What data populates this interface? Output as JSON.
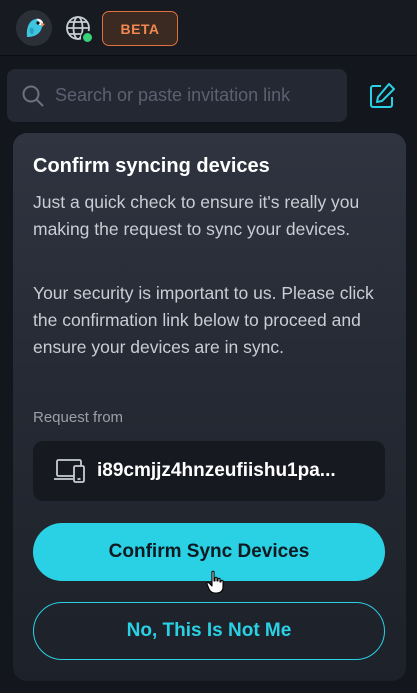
{
  "topbar": {
    "avatar_icon": "parrot-avatar-icon",
    "globe_icon": "globe-icon",
    "status_color": "#36d37a",
    "beta_label": "BETA"
  },
  "search": {
    "placeholder": "Search or paste invitation link",
    "value": "",
    "icon": "search-icon"
  },
  "compose_icon": "compose-icon",
  "card": {
    "title": "Confirm syncing devices",
    "paragraph1": "Just a quick check to ensure it's really you making the request to sync your devices.",
    "paragraph2": "Your security is important to us. Please click the confirmation link below to proceed and ensure your devices are in sync.",
    "request_label": "Request from",
    "device_icon": "devices-icon",
    "device_id": "i89cmjjz4hnzeufiishu1pa...",
    "confirm_label": "Confirm Sync Devices",
    "deny_label": "No, This Is Not Me"
  },
  "colors": {
    "accent": "#2ad1e4",
    "beta": "#f08850",
    "background": "#13161c"
  }
}
